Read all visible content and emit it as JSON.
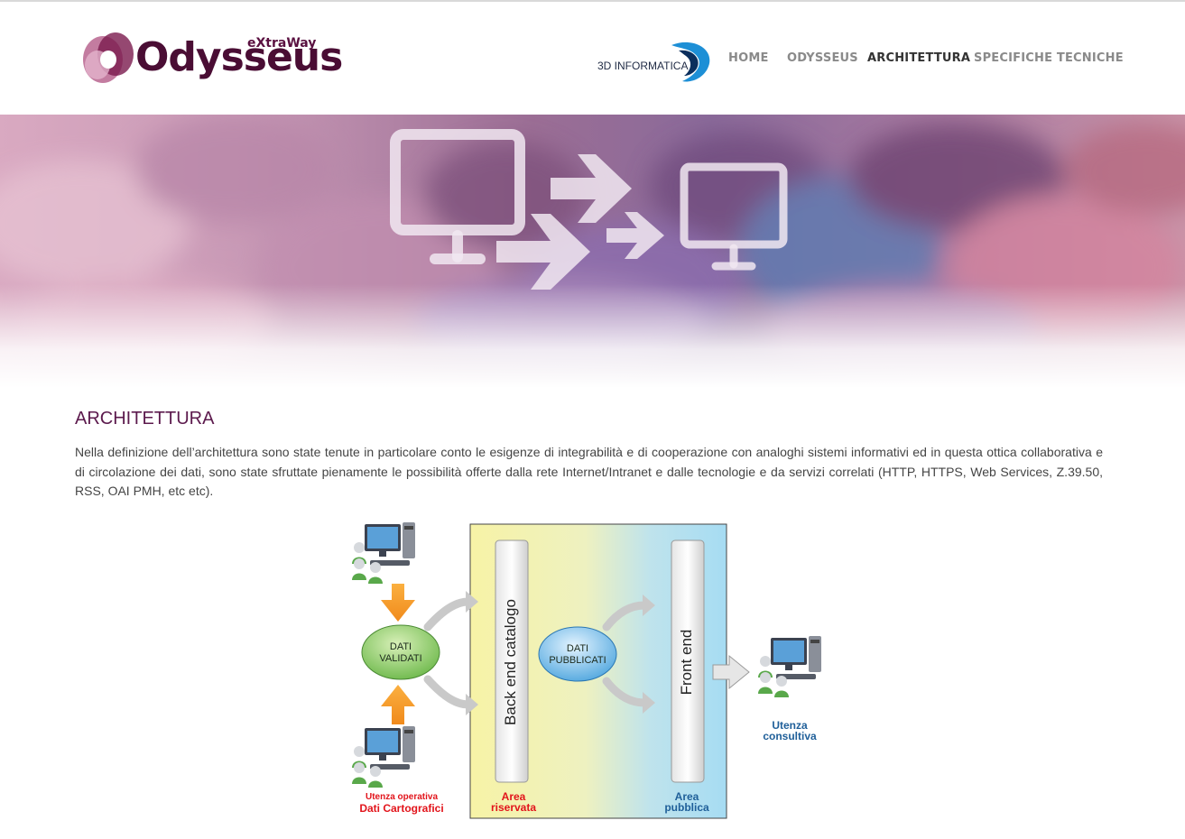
{
  "header": {
    "logo": {
      "brand": "Odysseus",
      "sub_brand": "eXtraWay"
    },
    "partner_logo": {
      "text": "3D INFORMATICA"
    },
    "nav": [
      {
        "label": "HOME",
        "active": false
      },
      {
        "label": "ODYSSEUS",
        "active": false
      },
      {
        "label": "ARCHITETTURA",
        "active": true
      },
      {
        "label": "SPECIFICHE TECNICHE",
        "active": false
      }
    ]
  },
  "hero": {
    "icon": "computer-transfer-icon"
  },
  "main": {
    "title": "ARCHITETTURA",
    "intro": "Nella definizione dell’architettura sono state tenute in particolare conto le esigenze di integrabilità e di cooperazione con analoghi sistemi informativi ed in questa ottica collaborativa e di circolazione dei dati, sono state sfruttate pienamente le possibilità offerte dalla rete Internet/Intranet e dalle tecnologie e da servizi correlati (HTTP, HTTPS, Web Services, Z.39.50, RSS, OAI PMH, etc etc)."
  },
  "diagram": {
    "dati_validati": "DATI VALIDATI",
    "dati_validati_l1": "DATI",
    "dati_validati_l2": "VALIDATI",
    "dati_pubblicati_l1": "DATI",
    "dati_pubblicati_l2": "PUBBLICATI",
    "back_end": "Back end catalogo",
    "front_end": "Front end",
    "utenza_operativa_l1": "Utenza operativa",
    "utenza_operativa_l2": "Dati Cartografici",
    "area_riservata_l1": "Area",
    "area_riservata_l2": "riservata",
    "area_pubblica_l1": "Area",
    "area_pubblica_l2": "pubblica",
    "utenza_consultiva_l1": "Utenza",
    "utenza_consultiva_l2": "consultiva"
  },
  "colors": {
    "brand": "#5c1a4d",
    "nav_inactive": "#8a8a8a",
    "nav_active": "#333333",
    "red_label": "#e2141b",
    "blue_label": "#1f5f99"
  }
}
